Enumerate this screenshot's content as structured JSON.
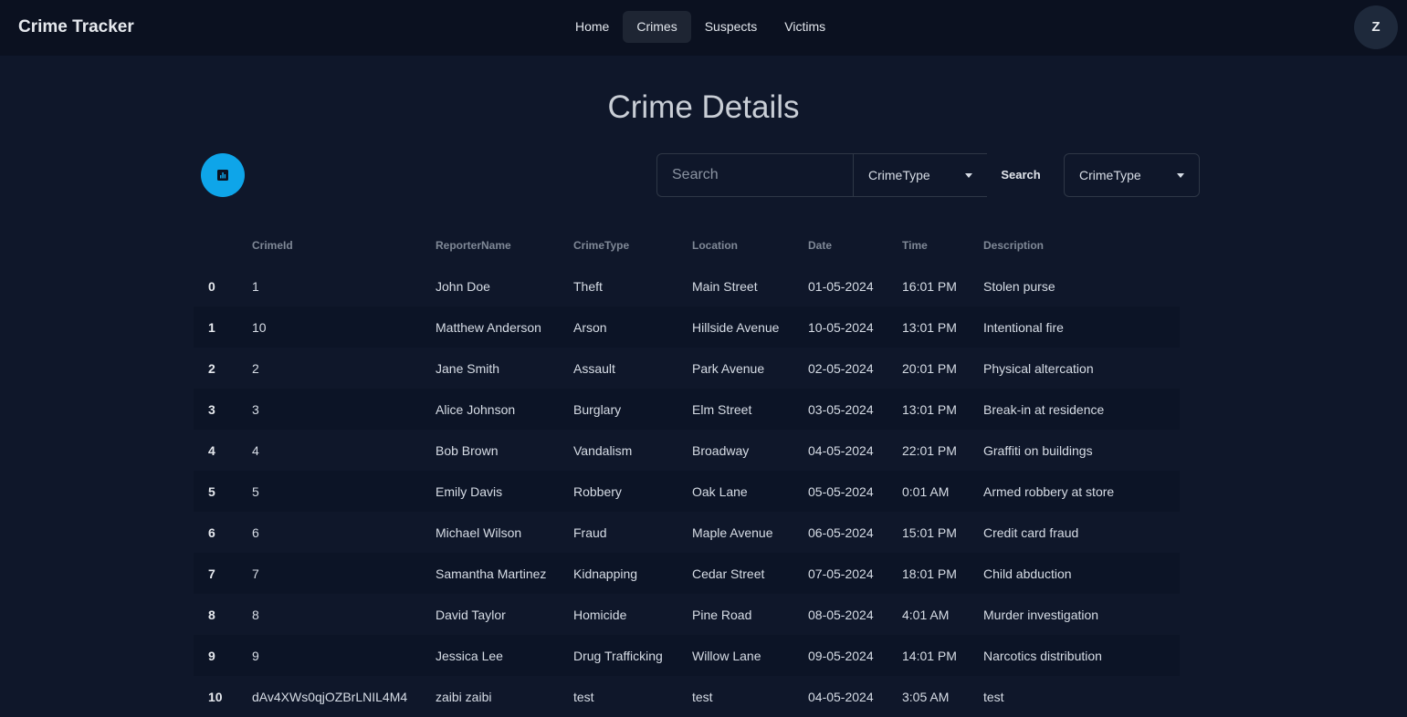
{
  "app": {
    "brand": "Crime Tracker",
    "nav": [
      "Home",
      "Crimes",
      "Suspects",
      "Victims"
    ],
    "active_nav": "Crimes",
    "avatar_initial": "Z"
  },
  "page": {
    "title": "Crime Details"
  },
  "toolbar": {
    "stats_button_icon": "bar-chart-icon",
    "search_placeholder": "Search",
    "search_select_value": "CrimeType",
    "search_button": "Search",
    "filter_select_value": "CrimeType"
  },
  "table": {
    "columns": [
      "",
      "CrimeId",
      "ReporterName",
      "CrimeType",
      "Location",
      "Date",
      "Time",
      "Description"
    ],
    "rows": [
      [
        "0",
        "1",
        "John Doe",
        "Theft",
        "Main Street",
        "01-05-2024",
        "16:01 PM",
        "Stolen purse"
      ],
      [
        "1",
        "10",
        "Matthew Anderson",
        "Arson",
        "Hillside Avenue",
        "10-05-2024",
        "13:01 PM",
        "Intentional fire"
      ],
      [
        "2",
        "2",
        "Jane Smith",
        "Assault",
        "Park Avenue",
        "02-05-2024",
        "20:01 PM",
        "Physical altercation"
      ],
      [
        "3",
        "3",
        "Alice Johnson",
        "Burglary",
        "Elm Street",
        "03-05-2024",
        "13:01 PM",
        "Break-in at residence"
      ],
      [
        "4",
        "4",
        "Bob Brown",
        "Vandalism",
        "Broadway",
        "04-05-2024",
        "22:01 PM",
        "Graffiti on buildings"
      ],
      [
        "5",
        "5",
        "Emily Davis",
        "Robbery",
        "Oak Lane",
        "05-05-2024",
        "0:01 AM",
        "Armed robbery at store"
      ],
      [
        "6",
        "6",
        "Michael Wilson",
        "Fraud",
        "Maple Avenue",
        "06-05-2024",
        "15:01 PM",
        "Credit card fraud"
      ],
      [
        "7",
        "7",
        "Samantha Martinez",
        "Kidnapping",
        "Cedar Street",
        "07-05-2024",
        "18:01 PM",
        "Child abduction"
      ],
      [
        "8",
        "8",
        "David Taylor",
        "Homicide",
        "Pine Road",
        "08-05-2024",
        "4:01 AM",
        "Murder investigation"
      ],
      [
        "9",
        "9",
        "Jessica Lee",
        "Drug Trafficking",
        "Willow Lane",
        "09-05-2024",
        "14:01 PM",
        "Narcotics distribution"
      ],
      [
        "10",
        "dAv4XWs0qjOZBrLNIL4M4",
        "zaibi zaibi",
        "test",
        "test",
        "04-05-2024",
        "3:05 AM",
        "test"
      ]
    ]
  }
}
